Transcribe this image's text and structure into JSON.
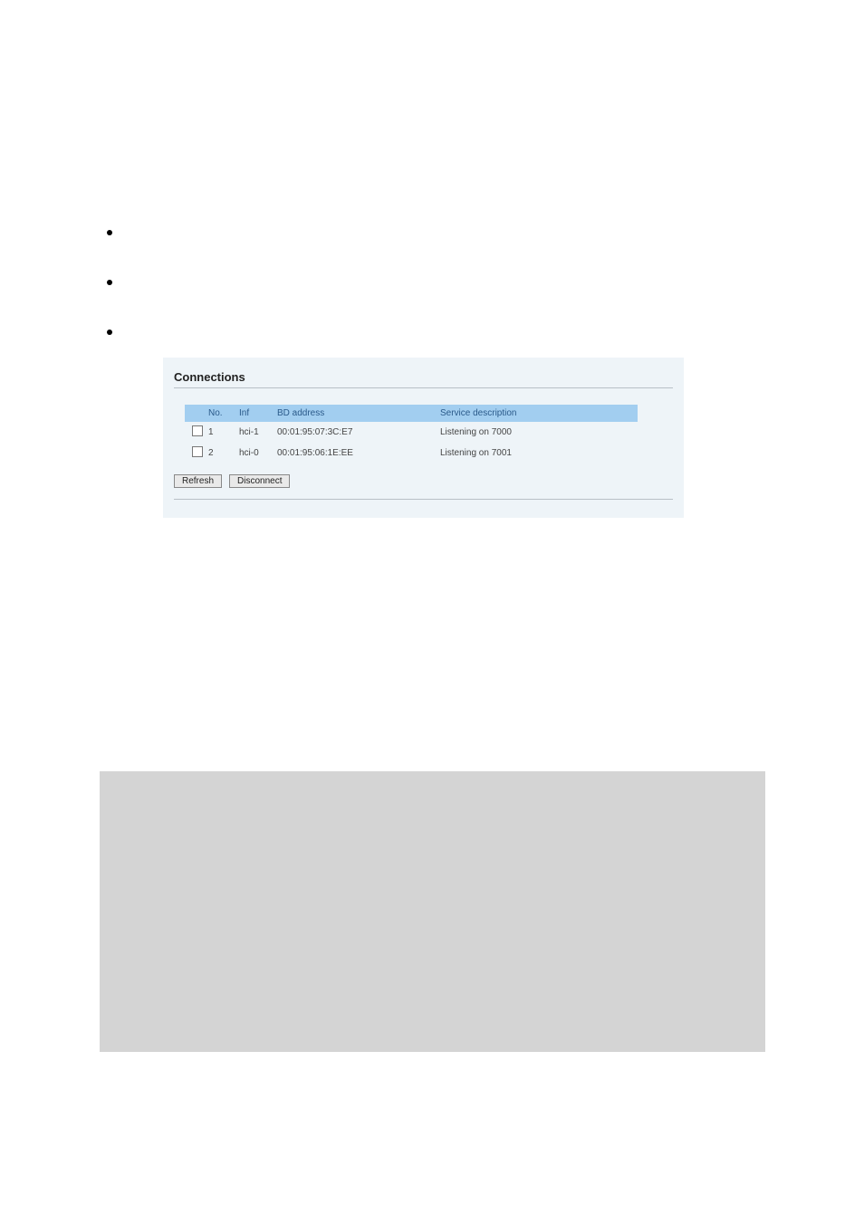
{
  "panel": {
    "title": "Connections",
    "columns": {
      "no": "No.",
      "inf": "Inf",
      "bd": "BD address",
      "sd": "Service description"
    },
    "rows": [
      {
        "no": "1",
        "inf": "hci-1",
        "bd": "00:01:95:07:3C:E7",
        "sd": "Listening on 7000"
      },
      {
        "no": "2",
        "inf": "hci-0",
        "bd": "00:01:95:06:1E:EE",
        "sd": "Listening on 7001"
      }
    ],
    "buttons": {
      "refresh": "Refresh",
      "disconnect": "Disconnect"
    }
  }
}
